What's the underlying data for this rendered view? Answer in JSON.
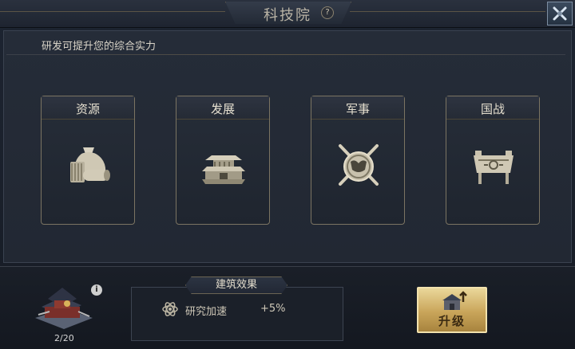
{
  "window": {
    "title": "科技院",
    "help_icon": "?",
    "close_icon": "close-x"
  },
  "subtitle": "研发可提升您的综合实力",
  "categories": [
    {
      "label": "资源",
      "icon": "resource-sack-icon"
    },
    {
      "label": "发展",
      "icon": "palace-icon"
    },
    {
      "label": "军事",
      "icon": "crossed-swords-shield-icon"
    },
    {
      "label": "国战",
      "icon": "bronze-cauldron-icon"
    }
  ],
  "building": {
    "level": "2/20",
    "info_icon": "i"
  },
  "effect": {
    "header": "建筑效果",
    "name": "研究加速",
    "value": "+5%"
  },
  "upgrade": {
    "label": "升级"
  },
  "colors": {
    "accent_gold": "#c9a55a",
    "panel": "#222833",
    "border": "#7b7462"
  }
}
